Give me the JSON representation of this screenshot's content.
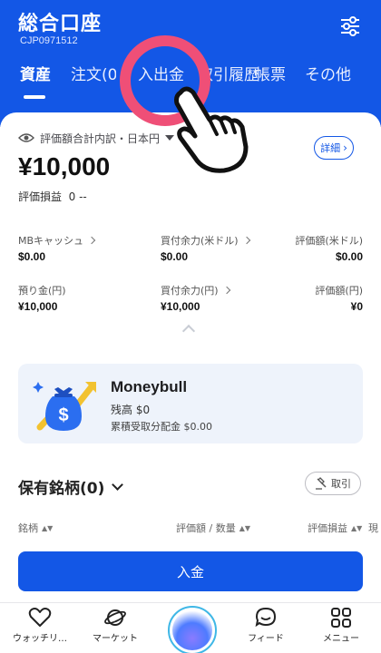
{
  "header": {
    "title": "総合口座",
    "account_id": "CJP0971512"
  },
  "tabs": [
    {
      "label": "資産",
      "active": true
    },
    {
      "label": "注文(0)",
      "active": false
    },
    {
      "label": "入出金",
      "active": false
    },
    {
      "label": "取引履歴",
      "active": false
    },
    {
      "label": "帳票",
      "active": false
    },
    {
      "label": "その他",
      "active": false
    }
  ],
  "summary": {
    "breakdown_label": "評価額合計内訳・日本円",
    "detail_button": "詳細",
    "total_value": "¥10,000",
    "pnl_label": "評価損益",
    "pnl_value": "0 --"
  },
  "balances": [
    {
      "label": "MBキャッシュ",
      "value": "$0.00",
      "has_chevron": true
    },
    {
      "label": "買付余力(米ドル)",
      "value": "$0.00",
      "has_chevron": true
    },
    {
      "label": "評価額(米ドル)",
      "value": "$0.00",
      "has_chevron": false
    },
    {
      "label": "預り金(円)",
      "value": "¥10,000",
      "has_chevron": false
    },
    {
      "label": "買付余力(円)",
      "value": "¥10,000",
      "has_chevron": true
    },
    {
      "label": "評価額(円)",
      "value": "¥0",
      "has_chevron": false
    }
  ],
  "moneybull": {
    "title": "Moneybull",
    "balance": "残高 $0",
    "distribution": "累積受取分配金 $0.00"
  },
  "holdings": {
    "title": "保有銘柄(0)",
    "trade_button": "取引",
    "columns": [
      "銘柄",
      "評価額 / 数量",
      "評価損益",
      "現"
    ]
  },
  "deposit_button": "入金",
  "nav": [
    {
      "label": "ウォッチリ…",
      "icon": "heart-icon"
    },
    {
      "label": "マーケット",
      "icon": "planet-icon"
    },
    {
      "label": "",
      "icon": "moneybull-center-icon"
    },
    {
      "label": "フィード",
      "icon": "chat-icon"
    },
    {
      "label": "メニュー",
      "icon": "menu-grid-icon"
    }
  ],
  "colors": {
    "brand_blue": "#1357e6",
    "annotation_pink": "#ef4f77",
    "card_bg": "#eef3fb"
  }
}
